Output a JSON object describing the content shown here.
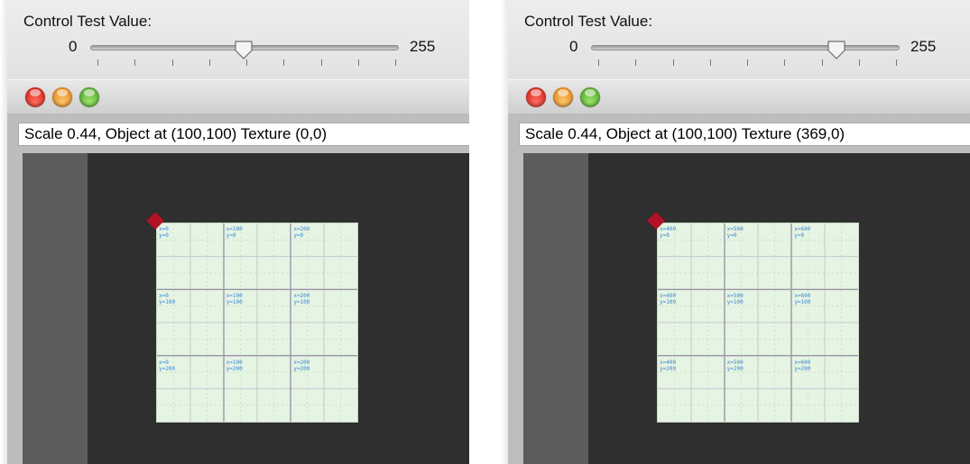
{
  "panels": [
    {
      "control": {
        "title": "Control Test Value:",
        "min_label": "0",
        "max_label": "255",
        "value_fraction": 0.5
      },
      "window": {
        "status_text": "Scale 0.44, Object at (100,100) Texture (0,0)"
      },
      "texture": {
        "labels": [
          [
            "x=0",
            "y=0"
          ],
          [
            "x=100",
            "y=0"
          ],
          [
            "x=200",
            "y=0"
          ],
          [
            "x=0",
            "y=100"
          ],
          [
            "x=100",
            "y=100"
          ],
          [
            "x=200",
            "y=100"
          ],
          [
            "x=0",
            "y=200"
          ],
          [
            "x=100",
            "y=200"
          ],
          [
            "x=200",
            "y=200"
          ]
        ]
      }
    },
    {
      "control": {
        "title": "Control Test Value:",
        "min_label": "0",
        "max_label": "255",
        "value_fraction": 0.8
      },
      "window": {
        "status_text": "Scale 0.44, Object at (100,100) Texture (369,0)"
      },
      "texture": {
        "labels": [
          [
            "x=400",
            "y=0"
          ],
          [
            "x=500",
            "y=0"
          ],
          [
            "x=600",
            "y=0"
          ],
          [
            "x=400",
            "y=100"
          ],
          [
            "x=500",
            "y=100"
          ],
          [
            "x=600",
            "y=100"
          ],
          [
            "x=400",
            "y=200"
          ],
          [
            "x=500",
            "y=200"
          ],
          [
            "x=600",
            "y=200"
          ]
        ]
      }
    }
  ],
  "colors": {
    "canvas_bg": "#2f2f2f",
    "canvas_sidebar": "#5c5c5c",
    "texture_bg": "#e5f4e3",
    "texture_label": "#3b87d8",
    "marker": "#b21226"
  },
  "icons": {
    "close": "red-traffic-light-icon",
    "minimize": "orange-traffic-light-icon",
    "zoom": "green-traffic-light-icon",
    "marker": "diamond-marker-icon"
  }
}
